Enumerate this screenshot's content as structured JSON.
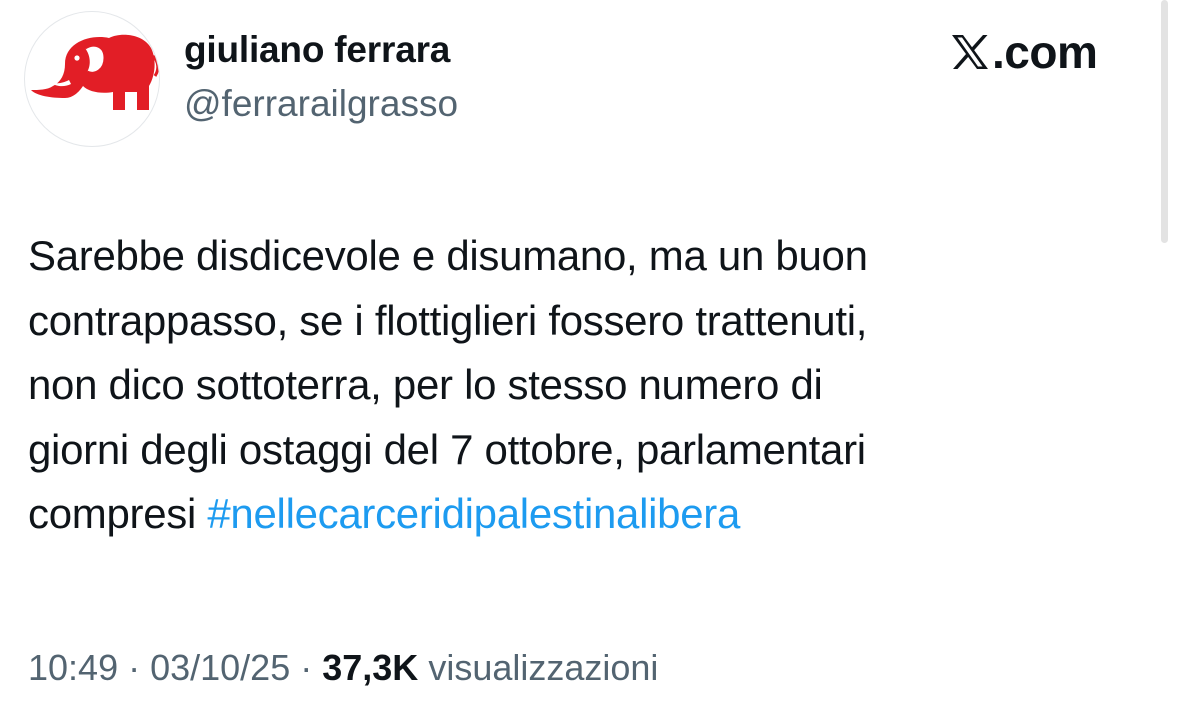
{
  "author": {
    "display_name": "giuliano ferrara",
    "handle": "@ferrarailgrasso",
    "avatar_icon": "red-elephant-icon",
    "avatar_color": "#e21e26"
  },
  "brand": {
    "icon": "x-logo-icon",
    "text": ".com"
  },
  "tweet": {
    "lines": [
      "Sarebbe disdicevole e disumano, ma un buon",
      "contrappasso, se i flottiglieri fossero trattenuti,",
      "non dico sottoterra, per lo stesso numero di",
      "giorni degli ostaggi del 7 ottobre, parlamentari",
      "compresi"
    ],
    "hashtag": "#nellecarceridipalestinalibera",
    "hashtag_color": "#1d9bf0"
  },
  "meta": {
    "time": "10:49",
    "separator": " · ",
    "date": "03/10/25",
    "views_count": "37,3K",
    "views_label": "visualizzazioni"
  }
}
